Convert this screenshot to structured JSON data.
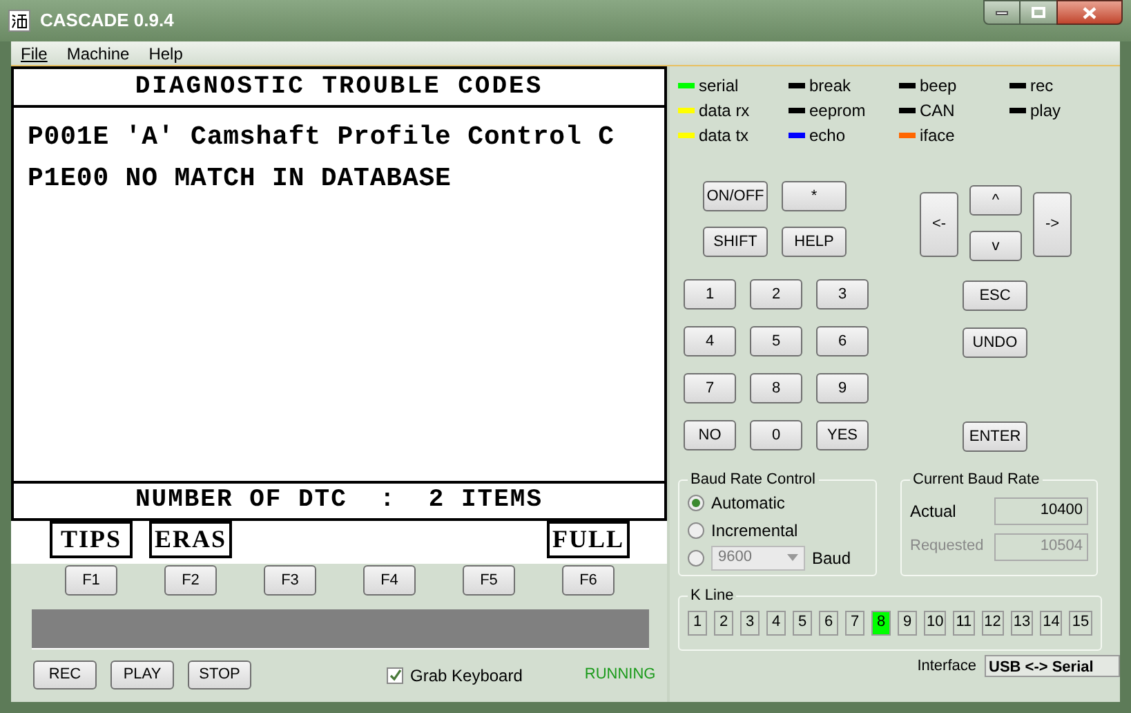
{
  "window": {
    "title": "CASCADE 0.9.4"
  },
  "menu": [
    {
      "label": "File",
      "mnemonic": true
    },
    {
      "label": "Machine",
      "mnemonic": false
    },
    {
      "label": "Help",
      "mnemonic": false
    }
  ],
  "display": {
    "header": "DIAGNOSTIC TROUBLE CODES",
    "lines": [
      "P001E 'A' Camshaft Profile Control C",
      "P1E00 NO MATCH IN DATABASE"
    ],
    "footer": "NUMBER OF DTC  :  2 ITEMS"
  },
  "softkeys": [
    {
      "label": "TIPS",
      "key": "F1"
    },
    {
      "label": "ERAS",
      "key": "F2"
    },
    {
      "key": "F3"
    },
    {
      "key": "F4"
    },
    {
      "key": "F5"
    },
    {
      "label": "FULL",
      "key": "F6"
    }
  ],
  "transport_buttons": [
    "REC",
    "PLAY",
    "STOP"
  ],
  "grab_keyboard": {
    "label": "Grab Keyboard",
    "checked": true
  },
  "status": "RUNNING",
  "leds": [
    {
      "label": "serial",
      "color": "#00ff00"
    },
    {
      "label": "data rx",
      "color": "#ffff00"
    },
    {
      "label": "data tx",
      "color": "#ffff00"
    },
    {
      "label": "break",
      "color": "#000000"
    },
    {
      "label": "eeprom",
      "color": "#000000"
    },
    {
      "label": "echo",
      "color": "#0000ff"
    },
    {
      "label": "beep",
      "color": "#000000"
    },
    {
      "label": "CAN",
      "color": "#000000"
    },
    {
      "label": "iface",
      "color": "#ff6600"
    },
    {
      "label": "rec",
      "color": "#000000"
    },
    {
      "label": "play",
      "color": "#000000"
    }
  ],
  "function_keys": [
    "ON/OFF",
    "*",
    "SHIFT",
    "HELP"
  ],
  "arrow_keys": {
    "left": "<-",
    "up": "^",
    "down": "v",
    "right": "->"
  },
  "number_keys": [
    "1",
    "2",
    "3",
    "4",
    "5",
    "6",
    "7",
    "8",
    "9",
    "NO",
    "0",
    "YES"
  ],
  "edit_keys": [
    "ESC",
    "UNDO",
    "ENTER"
  ],
  "baud_rate_control": {
    "title": "Baud Rate Control",
    "options": [
      {
        "kind": "label",
        "label": "Automatic",
        "selected": true
      },
      {
        "kind": "label",
        "label": "Incremental",
        "selected": false
      },
      {
        "kind": "select",
        "value": "9600",
        "suffix": "Baud",
        "selected": false
      }
    ]
  },
  "current_baud_rate": {
    "title": "Current Baud Rate",
    "actual_label": "Actual",
    "actual": "10400",
    "requested_label": "Requested",
    "requested": "10504"
  },
  "k_line": {
    "title": "K Line",
    "channels": [
      {
        "label": "1",
        "selected": false
      },
      {
        "label": "2",
        "selected": false
      },
      {
        "label": "3",
        "selected": false
      },
      {
        "label": "4",
        "selected": false
      },
      {
        "label": "5",
        "selected": false
      },
      {
        "label": "6",
        "selected": false
      },
      {
        "label": "7",
        "selected": false
      },
      {
        "label": "8",
        "selected": true
      },
      {
        "label": "9",
        "selected": false
      },
      {
        "label": "10",
        "selected": false
      },
      {
        "label": "11",
        "selected": false
      },
      {
        "label": "12",
        "selected": false
      },
      {
        "label": "13",
        "selected": false
      },
      {
        "label": "14",
        "selected": false
      },
      {
        "label": "15",
        "selected": false
      }
    ]
  },
  "interface": {
    "label": "Interface",
    "value": "USB <-> Serial"
  }
}
